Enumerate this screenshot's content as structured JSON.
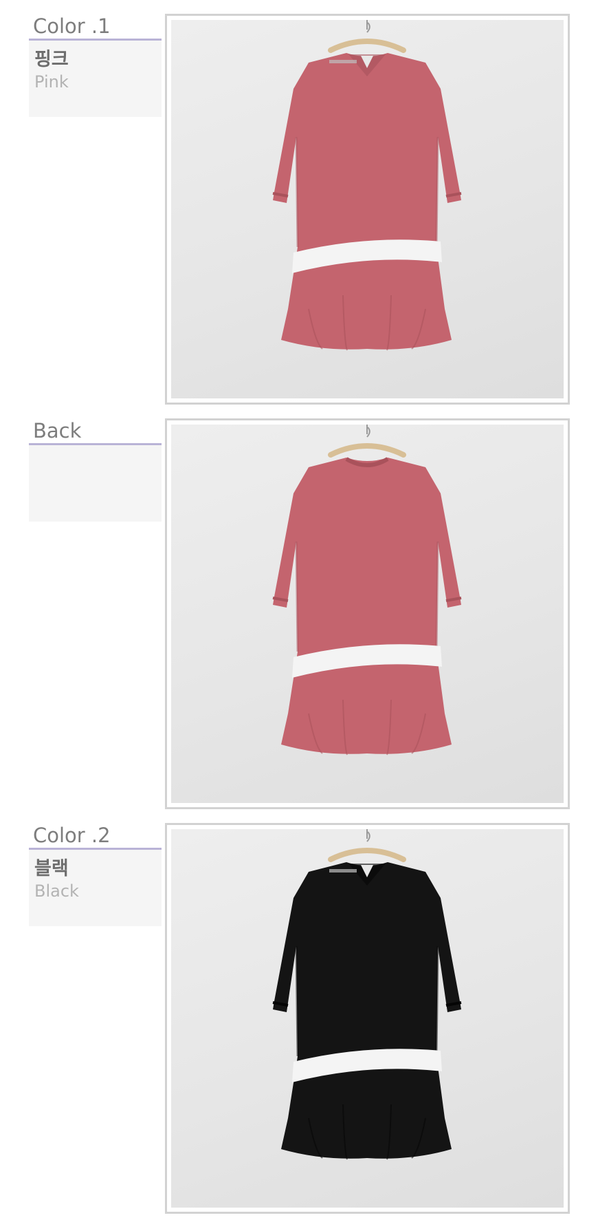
{
  "sections": [
    {
      "title": "Color .1",
      "name_ko": "핑크",
      "name_en": "Pink",
      "garment_color": "#c4646e",
      "garment_shadow": "#a9525b",
      "view": "front"
    },
    {
      "title": "Back",
      "name_ko": "",
      "name_en": "",
      "garment_color": "#c4646e",
      "garment_shadow": "#a9525b",
      "view": "back"
    },
    {
      "title": "Color .2",
      "name_ko": "블랙",
      "name_en": "Black",
      "garment_color": "#141414",
      "garment_shadow": "#050505",
      "view": "front"
    }
  ],
  "colors": {
    "title_text": "#7d7d7d",
    "title_underline": "#b9b3d6",
    "label_bg": "#f5f5f5",
    "frame_border": "#d2d2d2",
    "stripe": "#f4f4f4",
    "hanger": "#d8bf96"
  }
}
